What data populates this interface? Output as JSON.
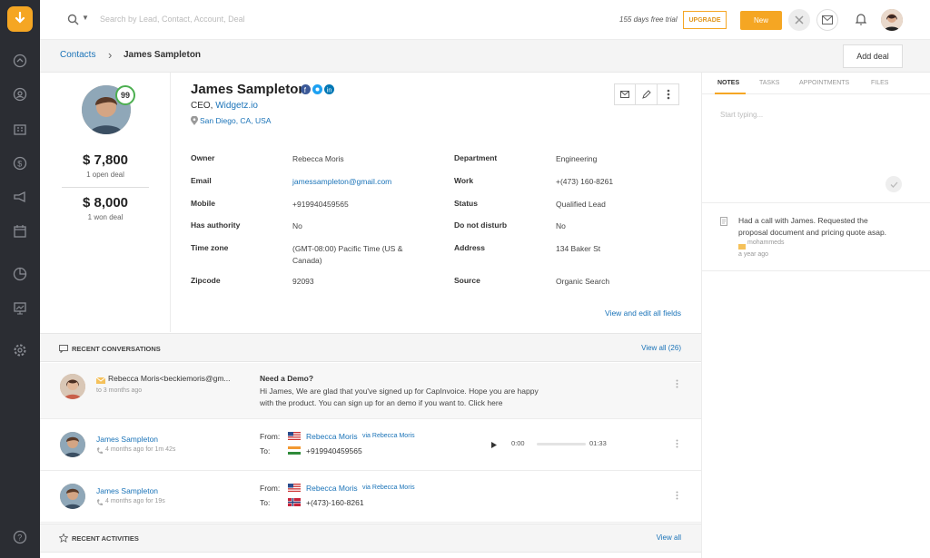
{
  "colors": {
    "brand": "#f5a623",
    "link": "#1a73b8",
    "sidebar": "#2b2d33"
  },
  "topbar": {
    "search_placeholder": "Search by Lead, Contact, Account, Deal",
    "trial_text": "155 days free trial",
    "upgrade_label": "UPGRADE",
    "new_label": "New"
  },
  "breadcrumb": {
    "parent": "Contacts",
    "separator": "›",
    "current": "James Sampleton",
    "add_deal_label": "Add deal"
  },
  "contact": {
    "name": "James Sampleton",
    "score": "99",
    "title_prefix": "CEO, ",
    "company": "Widgetz.io",
    "location": "San Diego, CA, USA",
    "open_amount": "$ 7,800",
    "open_label": "1 open deal",
    "won_amount": "$ 8,000",
    "won_label": "1 won deal"
  },
  "fields": [
    {
      "label": "Owner",
      "value": "Rebecca Moris"
    },
    {
      "label": "Email",
      "value": "jamessampleton@gmail.com"
    },
    {
      "label": "Mobile",
      "value": "+919940459565"
    },
    {
      "label": "Has authority",
      "value": "No"
    },
    {
      "label": "Time zone",
      "value": "(GMT-08:00) Pacific Time (US &",
      "value2": "Canada)"
    },
    {
      "label": "Zipcode",
      "value": "92093"
    }
  ],
  "fields_right": [
    {
      "label": "Department",
      "value": "Engineering"
    },
    {
      "label": "Work",
      "value": "+(473) 160-8261"
    },
    {
      "label": "Status",
      "value": "Qualified Lead"
    },
    {
      "label": "Do not disturb",
      "value": "No"
    },
    {
      "label": "Address",
      "value": "134 Baker St"
    },
    {
      "label": "Source",
      "value": "Organic Search"
    }
  ],
  "view_all_fields": "View and edit all fields",
  "conversations": {
    "title": "RECENT CONVERSATIONS",
    "view_all": "View all (26)",
    "email": {
      "from": "Rebecca Moris<beckiemoris@gm...",
      "time": "to 3 months ago",
      "subject": "Need a Demo?",
      "body1": "Hi James, We are glad that you've signed up for CapInvoice. Hope you are happy",
      "body2": "with the product. You can sign up for an demo if you want to.  Click here"
    },
    "calls": [
      {
        "name": "James Sampleton",
        "meta": "4 months ago for 1m 42s",
        "from_label": "From:",
        "from": "Rebecca Moris",
        "via": "via Rebecca Moris",
        "to_label": "To:",
        "to": "+919940459565",
        "start": "0:00",
        "end": "01:33"
      },
      {
        "name": "James Sampleton",
        "meta": "4 months ago for 19s",
        "from_label": "From:",
        "from": "Rebecca Moris",
        "via": "via Rebecca Moris",
        "to_label": "To:",
        "to": "+(473)-160-8261"
      }
    ]
  },
  "activities": {
    "title": "RECENT ACTIVITIES",
    "view_all": "View all"
  },
  "notes": {
    "tabs": [
      "NOTES",
      "TASKS",
      "APPOINTMENTS",
      "FILES"
    ],
    "placeholder": "Start typing...",
    "note_line1": "Had a call with James. Requested the",
    "note_line2": "proposal document and pricing quote asap.",
    "author": "mohammeds",
    "time": "a year ago"
  }
}
